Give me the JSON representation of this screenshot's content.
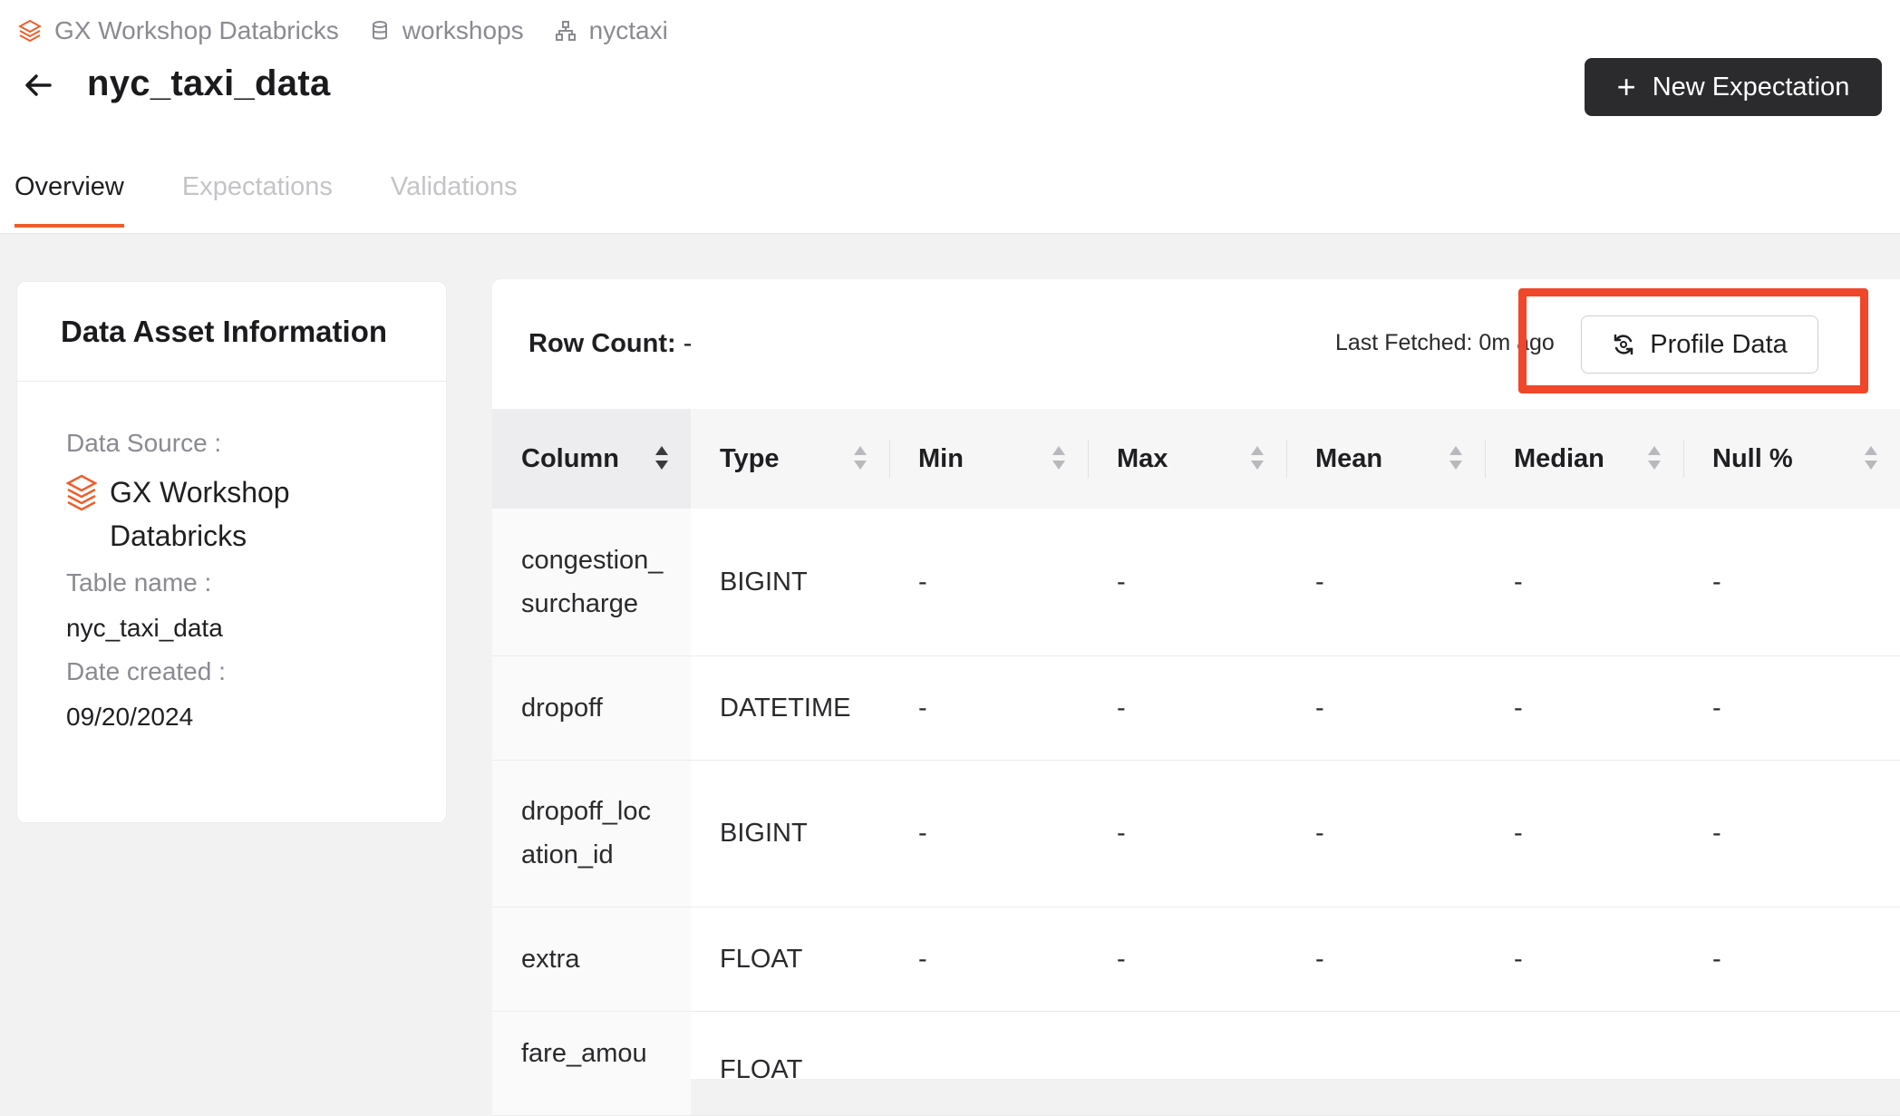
{
  "breadcrumb": {
    "items": [
      {
        "label": "GX Workshop Databricks",
        "icon": "databricks-icon"
      },
      {
        "label": "workshops",
        "icon": "database-icon"
      },
      {
        "label": "nyctaxi",
        "icon": "schema-icon"
      }
    ]
  },
  "page": {
    "title": "nyc_taxi_data",
    "new_expectation_label": "New Expectation"
  },
  "tabs": [
    {
      "label": "Overview",
      "active": true
    },
    {
      "label": "Expectations",
      "active": false
    },
    {
      "label": "Validations",
      "active": false
    }
  ],
  "asset_info": {
    "heading": "Data Asset Information",
    "data_source_label": "Data Source",
    "data_source_value_line1": "GX Workshop",
    "data_source_value_line2": "Databricks",
    "table_name_label": "Table name",
    "table_name_value": "nyc_taxi_data",
    "date_created_label": "Date created",
    "date_created_value": "09/20/2024"
  },
  "profile": {
    "row_count_label": "Row Count:",
    "row_count_value": "-",
    "last_fetched": "Last Fetched: 0m ago",
    "profile_button": "Profile Data"
  },
  "table": {
    "headers": [
      "Column",
      "Type",
      "Min",
      "Max",
      "Mean",
      "Median",
      "Null %"
    ],
    "rows": [
      {
        "col1": "congestion_",
        "col2": "surcharge",
        "type": "BIGINT",
        "min": "-",
        "max": "-",
        "mean": "-",
        "median": "-",
        "null": "-"
      },
      {
        "col1": "dropoff",
        "col2": "",
        "type": "DATETIME",
        "min": "-",
        "max": "-",
        "mean": "-",
        "median": "-",
        "null": "-"
      },
      {
        "col1": "dropoff_loc",
        "col2": "ation_id",
        "type": "BIGINT",
        "min": "-",
        "max": "-",
        "mean": "-",
        "median": "-",
        "null": "-"
      },
      {
        "col1": "extra",
        "col2": "",
        "type": "FLOAT",
        "min": "-",
        "max": "-",
        "mean": "-",
        "median": "-",
        "null": "-"
      },
      {
        "col1": "fare_amou",
        "col2": "",
        "type": "FLOAT",
        "min": "",
        "max": "",
        "mean": "",
        "median": "",
        "null": ""
      }
    ]
  },
  "colors": {
    "accent": "#ef5d2a",
    "highlight": "#f0462a",
    "button_dark": "#2b2b2e"
  }
}
